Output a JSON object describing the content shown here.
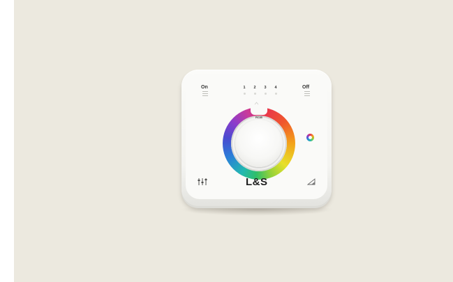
{
  "scene": {
    "background_color": "#ece9df",
    "panel_color": "#fafaf8"
  },
  "panel": {
    "on_label": "On",
    "off_label": "Off",
    "zones": [
      "1",
      "2",
      "3",
      "4"
    ],
    "wheel_label": "RGB",
    "brand": "L&S"
  },
  "icons": {
    "top_left": "list-icon",
    "top_right": "list-icon",
    "right_middle": "color-wheel-icon",
    "bottom_left": "equalizer-icon",
    "bottom_right": "dimmer-icon"
  }
}
